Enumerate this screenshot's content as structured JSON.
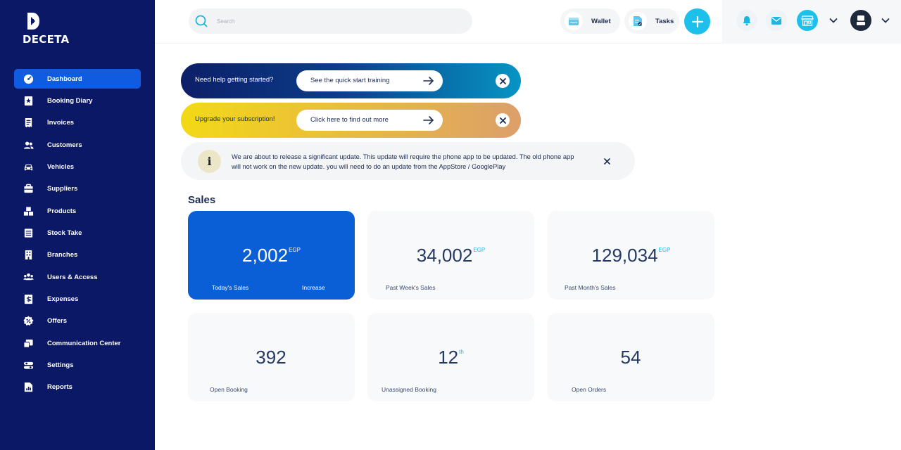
{
  "brand": {
    "name": "DECETA"
  },
  "sidebar": {
    "items": [
      {
        "label": "Dashboard",
        "icon": "dashboard-icon"
      },
      {
        "label": "Booking Diary",
        "icon": "booking-icon"
      },
      {
        "label": "Invoices",
        "icon": "invoice-icon"
      },
      {
        "label": "Customers",
        "icon": "customers-icon"
      },
      {
        "label": "Vehicles",
        "icon": "car-icon"
      },
      {
        "label": "Suppliers",
        "icon": "suppliers-icon"
      },
      {
        "label": "Products",
        "icon": "products-icon"
      },
      {
        "label": "Stock Take",
        "icon": "stock-icon"
      },
      {
        "label": "Branches",
        "icon": "building-icon"
      },
      {
        "label": "Users & Access",
        "icon": "users-icon"
      },
      {
        "label": "Expenses",
        "icon": "expenses-icon"
      },
      {
        "label": "Offers",
        "icon": "offers-icon"
      },
      {
        "label": "Communication Center",
        "icon": "communication-icon"
      },
      {
        "label": "Settings",
        "icon": "settings-icon"
      },
      {
        "label": "Reports",
        "icon": "reports-icon"
      }
    ]
  },
  "header": {
    "search_placeholder": "Search",
    "wallet_label": "Wallet",
    "tasks_label": "Tasks"
  },
  "banners": {
    "help": {
      "text": "Need help getting started?",
      "button": "See the quick start training"
    },
    "upgrade": {
      "text": "Upgrade your subscription!",
      "button": "Click here to find out more"
    }
  },
  "notice": {
    "icon": "i",
    "text": "We are about to release a significant update. This update will require the phone app to be updated. The old phone app will not work on the new update. you will need to do an update from the AppStore / GooglePlay"
  },
  "sales": {
    "title": "Sales",
    "cards": [
      {
        "value": "2,002",
        "sup": "EGP",
        "label": "Today's Sales",
        "label2": "Increase"
      },
      {
        "value": "34,002",
        "sup": "EGP",
        "label": "Past Week's Sales"
      },
      {
        "value": "129,034",
        "sup": "EGP",
        "label": "Past Month's Sales"
      },
      {
        "value": "392",
        "sup": "",
        "label": "Open Booking"
      },
      {
        "value": "12",
        "sup": "th",
        "label": "Unassigned Booking"
      },
      {
        "value": "54",
        "sup": "",
        "label": "Open Orders"
      }
    ]
  },
  "colors": {
    "sidebar_bg": "#0a1866",
    "active_item": "#0f5ce0",
    "accent_cyan": "#1cc0ea",
    "card_blue": "#0b5fd6"
  }
}
